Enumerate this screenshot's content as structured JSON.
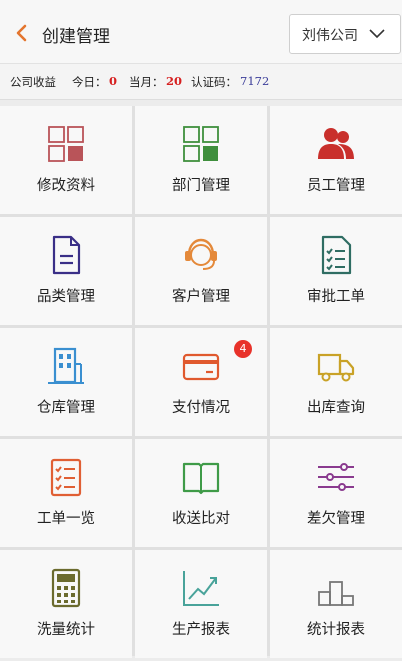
{
  "header": {
    "title": "创建管理",
    "company": "刘伟公司"
  },
  "info": {
    "income_label": "公司收益",
    "today_label": "今日：",
    "today_value": "0",
    "month_label": "当月：",
    "month_value": "20",
    "code_label": "认证码：",
    "code_value": "7172"
  },
  "menu": [
    {
      "label": "修改资料",
      "icon": "edit-profile-grid-icon",
      "color": "#b95459"
    },
    {
      "label": "部门管理",
      "icon": "department-grid-icon",
      "color": "#3f8f3d"
    },
    {
      "label": "员工管理",
      "icon": "employees-icon",
      "color": "#c9302c"
    },
    {
      "label": "品类管理",
      "icon": "category-document-icon",
      "color": "#3a2f87"
    },
    {
      "label": "客户管理",
      "icon": "customer-headset-icon",
      "color": "#e4893a"
    },
    {
      "label": "审批工单",
      "icon": "approval-checklist-icon",
      "color": "#2f6d63"
    },
    {
      "label": "仓库管理",
      "icon": "warehouse-building-icon",
      "color": "#3a8fd0"
    },
    {
      "label": "支付情况",
      "icon": "payment-card-icon",
      "color": "#e0592e",
      "badge": "4"
    },
    {
      "label": "出库查询",
      "icon": "delivery-truck-icon",
      "color": "#c9a227"
    },
    {
      "label": "工单一览",
      "icon": "work-order-checklist-icon",
      "color": "#e05f34"
    },
    {
      "label": "收送比对",
      "icon": "compare-book-icon",
      "color": "#3f9b48"
    },
    {
      "label": "差欠管理",
      "icon": "arrears-sliders-icon",
      "color": "#8a3b8f"
    },
    {
      "label": "洗量统计",
      "icon": "wash-calculator-icon",
      "color": "#6b6b2e"
    },
    {
      "label": "生产报表",
      "icon": "production-trend-icon",
      "color": "#49a39a"
    },
    {
      "label": "统计报表",
      "icon": "statistics-podium-icon",
      "color": "#777777"
    }
  ]
}
